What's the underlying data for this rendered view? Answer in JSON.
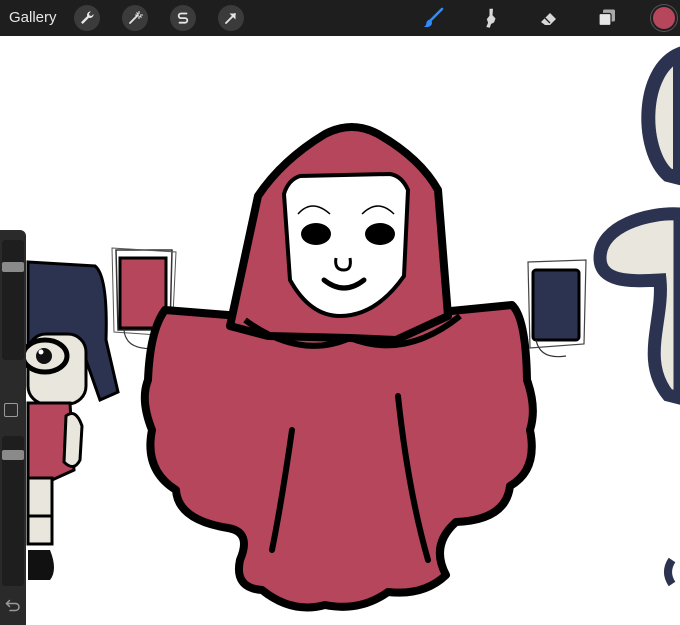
{
  "topbar": {
    "gallery_label": "Gallery",
    "left_tools": [
      {
        "name": "actions",
        "icon": "wrench-icon"
      },
      {
        "name": "adjustments",
        "icon": "magic-wand-icon"
      },
      {
        "name": "selection",
        "icon": "selection-s-icon"
      },
      {
        "name": "transform",
        "icon": "arrow-cursor-icon"
      }
    ],
    "right_tools": [
      {
        "name": "brush",
        "icon": "brush-icon",
        "active": true
      },
      {
        "name": "smudge",
        "icon": "smudge-icon"
      },
      {
        "name": "eraser",
        "icon": "eraser-icon"
      },
      {
        "name": "layers",
        "icon": "layers-icon"
      }
    ],
    "current_color": "#b5465c",
    "active_color": "#2f8cff"
  },
  "sidebar": {
    "brush_size_level": 0.2,
    "opacity_level": 0.1,
    "modify_icon": "square-icon",
    "undo_icon": "undo-icon"
  },
  "canvas": {
    "colors": {
      "robe": "#b5465c",
      "outline": "#000000",
      "mask": "#ffffff",
      "navy": "#2c3350",
      "cream": "#e8e6dd"
    }
  }
}
